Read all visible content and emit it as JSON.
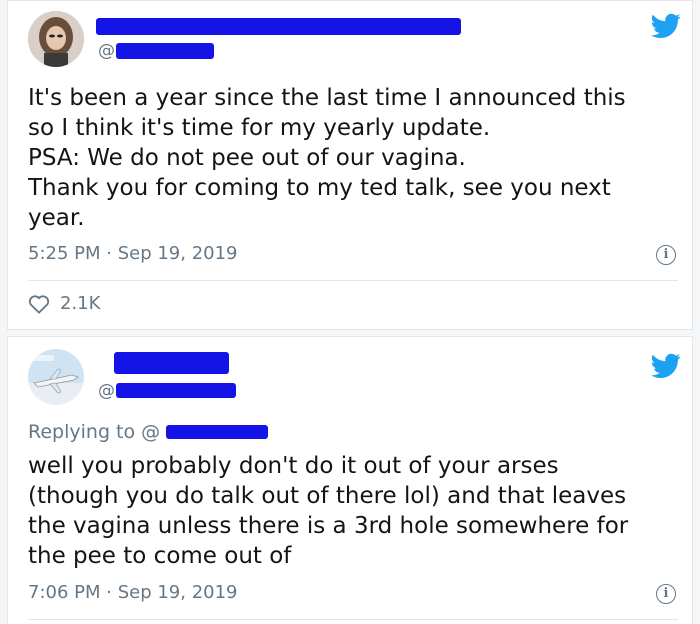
{
  "tweet1": {
    "handle_prefix": "@",
    "lines": [
      "It's been a year since the last time I announced this",
      "so I think it's time for my yearly update.",
      "PSA: We do not pee out of our vagina.",
      "Thank you for coming to my ted talk, see you next",
      "year."
    ],
    "timestamp": "5:25 PM · Sep 19, 2019",
    "likes": "2.1K"
  },
  "tweet2": {
    "handle_prefix": "@",
    "replying_to": "Replying to @",
    "lines": [
      "well you probably don't do it out of your arses",
      "(though you do talk out of there lol) and that leaves",
      "the vagina unless there is a 3rd hole somewhere for",
      "the pee to come out of"
    ],
    "timestamp": "7:06 PM · Sep 19, 2019"
  },
  "icons": {
    "bird": "twitter-bird-icon",
    "info": "info-icon",
    "heart": "heart-icon"
  },
  "colors": {
    "accent": "#1da1f2",
    "redaction": "#1414e6",
    "secondary_text": "#657786"
  }
}
